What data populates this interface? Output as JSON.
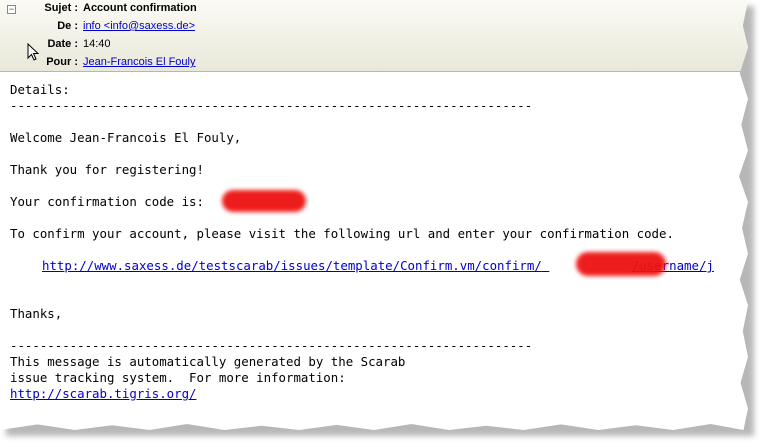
{
  "header": {
    "subject_label": "Sujet :",
    "subject_value": "Account confirmation",
    "from_label": "De :",
    "from_value": "info <info@saxess.de>",
    "date_label": "Date :",
    "date_value": "14:40",
    "to_label": "Pour :",
    "to_value": "Jean-Francois El Fouly",
    "collapse_symbol": "−"
  },
  "body": {
    "details": "Details:",
    "rule1": "----------------------------------------------------------------------",
    "welcome": "Welcome Jean-Francois El Fouly,",
    "thanks_register": "Thank you for registering!",
    "code_line": "Your confirmation code is: ",
    "instructions": "To confirm your account, please visit the following url and enter your confirmation code.",
    "confirm_url_a": "http://www.saxess.de/testscarab/issues/template/Confirm.vm/confirm/",
    "confirm_url_b": "/username/j",
    "thanks": "Thanks,",
    "rule2": "----------------------------------------------------------------------",
    "footer1": "This message is automatically generated by the Scarab",
    "footer2": "issue tracking system.  For more information:",
    "footer_url": "http://scarab.tigris.org/"
  },
  "colors": {
    "link": "#0000cc",
    "redaction": "#ee1111",
    "header_bg": "#eeeddf"
  }
}
